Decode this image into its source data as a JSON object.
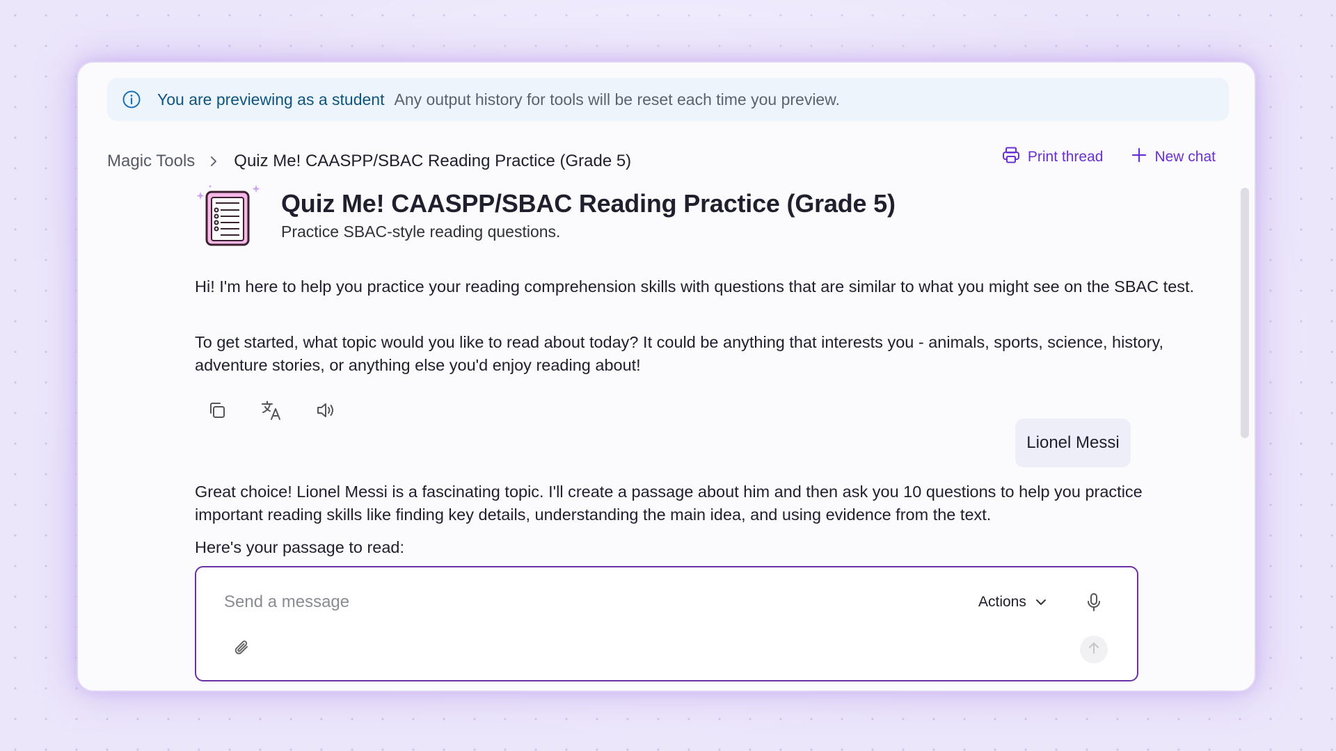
{
  "banner": {
    "icon": "info-icon",
    "title": "You are previewing as a student",
    "description": "Any output history for tools will be reset each time you preview."
  },
  "breadcrumb": {
    "root": "Magic Tools",
    "separator_icon": "chevron-right-icon",
    "current": "Quiz Me! CAASPP/SBAC Reading Practice (Grade 5)"
  },
  "top_actions": {
    "print_label": "Print thread",
    "print_icon": "printer-icon",
    "new_chat_label": "New chat",
    "new_chat_icon": "plus-icon"
  },
  "tool": {
    "icon": "quiz-document-icon",
    "title": "Quiz Me! CAASPP/SBAC Reading Practice (Grade 5)",
    "subtitle": "Practice SBAC-style reading questions."
  },
  "messages": {
    "assistant_1_p1": "Hi! I'm here to help you practice your reading comprehension skills with questions that are similar to what you might see on the SBAC test.",
    "assistant_1_p2": "To get started, what topic would you like to read about today? It could be anything that interests you - animals, sports, science, history, adventure stories, or anything else you'd enjoy reading about!",
    "message_actions": [
      "copy-icon",
      "translate-icon",
      "speaker-icon"
    ],
    "user_1": "Lionel Messi",
    "assistant_2_p1": "Great choice! Lionel Messi is a fascinating topic. I'll create a passage about him and then ask you 10 questions to help you practice important reading skills like finding key details, understanding the main idea, and using evidence from the text.",
    "assistant_2_p2": "Here's your passage to read:"
  },
  "composer": {
    "placeholder": "Send a message",
    "value": "",
    "actions_label": "Actions",
    "actions_icon": "chevron-down-icon",
    "mic_icon": "microphone-icon",
    "attach_icon": "paperclip-icon",
    "send_icon": "arrow-up-icon"
  },
  "colors": {
    "accent": "#6b2fd6",
    "composer_border": "#6b2fa8",
    "banner_bg": "#edf4fb",
    "banner_title": "#0d5580"
  }
}
